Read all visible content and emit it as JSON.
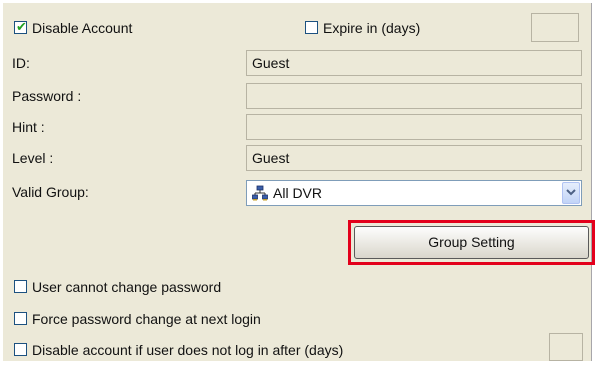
{
  "options": {
    "disable_account_label": "Disable Account",
    "disable_account_checked": true,
    "expire_label": "Expire in (days)",
    "expire_checked": false,
    "expire_value": ""
  },
  "fields": {
    "id_label": "ID:",
    "id_value": "Guest",
    "password_label": "Password :",
    "password_value": "",
    "hint_label": "Hint :",
    "hint_value": "",
    "level_label": "Level :",
    "level_value": "Guest",
    "valid_group_label": "Valid Group:",
    "valid_group_value": "All DVR",
    "valid_group_icon": "dvr-group-icon",
    "dropdown_icon": "chevron-down-icon"
  },
  "group_setting_label": "Group Setting",
  "accent_highlight": "#e3001b",
  "bottom_options": {
    "cannot_change_label": "User cannot change password",
    "force_change_label": "Force password change at next login",
    "disable_inactive_label": "Disable account if user does not log in after (days)",
    "disable_inactive_value": ""
  }
}
